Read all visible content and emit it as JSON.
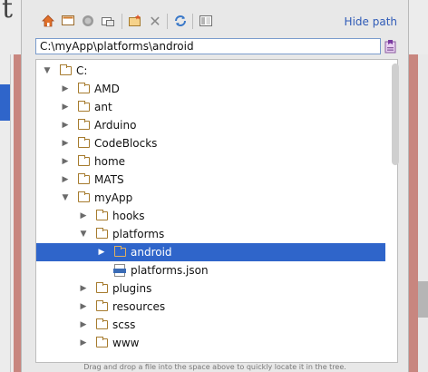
{
  "background": {
    "corner_text": "t"
  },
  "toolbar": {
    "icons": [
      "home-icon",
      "desktop-icon",
      "project-icon",
      "module-icon",
      "new-folder-icon",
      "delete-icon",
      "refresh-icon",
      "show-hidden-icon"
    ],
    "hide_path_label": "Hide path"
  },
  "path": {
    "value": "C:\\myApp\\platforms\\android"
  },
  "tree": {
    "rows": [
      {
        "label": "C:",
        "type": "folder",
        "level": 0,
        "expanded": true
      },
      {
        "label": "AMD",
        "type": "folder",
        "level": 1,
        "expanded": false
      },
      {
        "label": "ant",
        "type": "folder",
        "level": 1,
        "expanded": false
      },
      {
        "label": "Arduino",
        "type": "folder",
        "level": 1,
        "expanded": false
      },
      {
        "label": "CodeBlocks",
        "type": "folder",
        "level": 1,
        "expanded": false
      },
      {
        "label": "home",
        "type": "folder",
        "level": 1,
        "expanded": false
      },
      {
        "label": "MATS",
        "type": "folder",
        "level": 1,
        "expanded": false
      },
      {
        "label": "myApp",
        "type": "folder",
        "level": 1,
        "expanded": true
      },
      {
        "label": "hooks",
        "type": "folder",
        "level": 2,
        "expanded": false
      },
      {
        "label": "platforms",
        "type": "folder",
        "level": 2,
        "expanded": true
      },
      {
        "label": "android",
        "type": "folder",
        "level": 3,
        "expanded": false,
        "selected": true
      },
      {
        "label": "platforms.json",
        "type": "json",
        "level": 3
      },
      {
        "label": "plugins",
        "type": "folder",
        "level": 2,
        "expanded": false
      },
      {
        "label": "resources",
        "type": "folder",
        "level": 2,
        "expanded": false
      },
      {
        "label": "scss",
        "type": "folder",
        "level": 2,
        "expanded": false
      },
      {
        "label": "www",
        "type": "folder",
        "level": 2,
        "expanded": false
      }
    ]
  },
  "footer": {
    "hint": "Drag and drop a file into the space above to quickly locate it in the tree."
  },
  "colors": {
    "selection": "#2f65ca",
    "link": "#2f5bb7",
    "folder": "#a67b2e"
  }
}
